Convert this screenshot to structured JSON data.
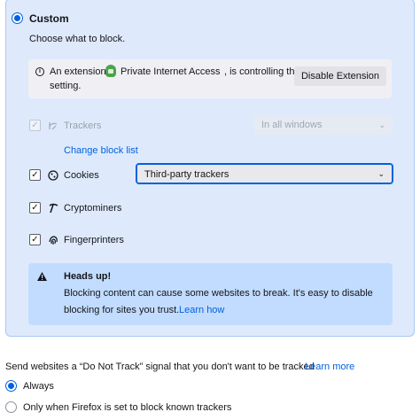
{
  "custom": {
    "title": "Custom",
    "subtitle": "Choose what to block.",
    "extension_notice": {
      "prefix": "An extension,",
      "extension_name": "Private Internet Access",
      "suffix": ", is controlling this",
      "line2": "setting.",
      "button_label": "Disable Extension"
    },
    "rows": [
      {
        "label": "Trackers",
        "checked": true,
        "disabled": true,
        "select_value": "In all windows",
        "link": "Change block list"
      },
      {
        "label": "Cookies",
        "checked": true,
        "disabled": false,
        "select_value": "Third-party trackers"
      },
      {
        "label": "Cryptominers",
        "checked": true,
        "disabled": false
      },
      {
        "label": "Fingerprinters",
        "checked": true,
        "disabled": false
      }
    ],
    "heads_up": {
      "title": "Heads up!",
      "line1": "Blocking content can cause some websites to break. It's easy to disable",
      "line2": "blocking for sites you trust.",
      "link": "Learn how"
    }
  },
  "dnt": {
    "label": "Send websites a “Do Not Track” signal that you don't want to be tracked",
    "link": "Learn more",
    "options": [
      {
        "label": "Always",
        "selected": true
      },
      {
        "label": "Only when Firefox is set to block known trackers",
        "selected": false
      }
    ]
  },
  "colors": {
    "accent": "#0061e0",
    "panel_bg": "#deeafc",
    "heads_up_bg": "#c2dcff"
  }
}
